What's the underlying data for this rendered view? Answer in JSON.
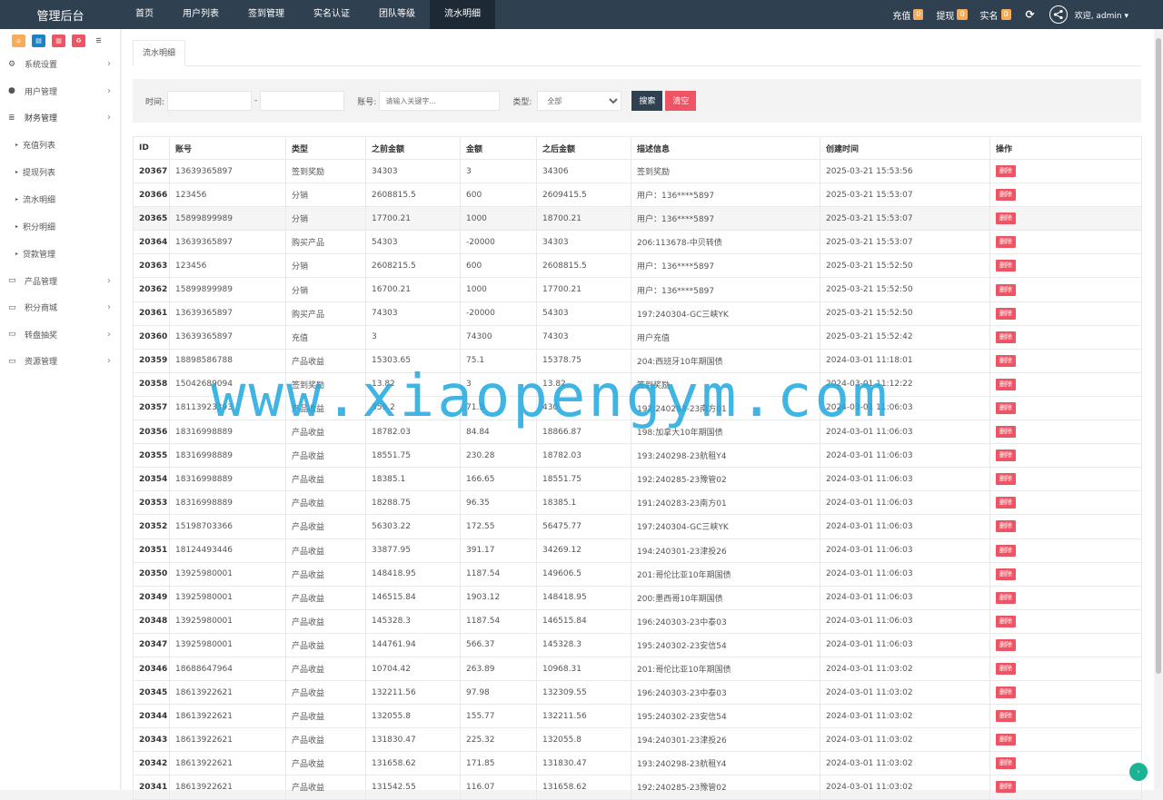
{
  "brand": "管理后台",
  "topnav": [
    "首页",
    "用户列表",
    "签到管理",
    "实名认证",
    "团队等级",
    "流水明细"
  ],
  "stats": [
    {
      "label": "充值",
      "count": "0"
    },
    {
      "label": "提现",
      "count": "0"
    },
    {
      "label": "实名",
      "count": "0"
    }
  ],
  "refresh_glyph": "⟳",
  "welcome": "欢迎, admin ▾",
  "quick_buttons": [
    {
      "icon": "home-icon",
      "glyph": "⌂",
      "color": "#f8ac59"
    },
    {
      "icon": "file-icon",
      "glyph": "▤",
      "color": "#1c84c6"
    },
    {
      "icon": "trash-icon",
      "glyph": "▥",
      "color": "#ed5565"
    },
    {
      "icon": "recycle-icon",
      "glyph": "♻",
      "color": "#ed5565"
    },
    {
      "icon": "list-icon",
      "glyph": "☰",
      "color": "#ffffff"
    }
  ],
  "sidebar": {
    "menus": [
      {
        "label": "系统设置",
        "icon": "gears-icon",
        "glyph": "⚙"
      },
      {
        "label": "用户管理",
        "icon": "user-icon",
        "glyph": "●"
      },
      {
        "label": "财务管理",
        "icon": "database-icon",
        "glyph": "≣"
      },
      {
        "label": "产品管理",
        "icon": "monitor-icon",
        "glyph": "▭"
      },
      {
        "label": "积分商城",
        "icon": "monitor-icon",
        "glyph": "▭"
      },
      {
        "label": "转盘抽奖",
        "icon": "monitor-icon",
        "glyph": "▭"
      },
      {
        "label": "资源管理",
        "icon": "monitor-icon",
        "glyph": "▭"
      }
    ],
    "finance_sub": [
      "充值列表",
      "提现列表",
      "流水明细",
      "积分明细",
      "贷款管理"
    ],
    "chevron": "›",
    "dot": "▸"
  },
  "tab_label": "流水明细",
  "search": {
    "time_label": "时间:",
    "dash": "-",
    "account_label": "账号:",
    "account_placeholder": "请输入关键字...",
    "type_label": "类型:",
    "type_selected": "全部",
    "search_btn": "搜索",
    "clear_btn": "清空"
  },
  "table": {
    "headers": [
      "ID",
      "账号",
      "类型",
      "之前金额",
      "金额",
      "之后金额",
      "描述信息",
      "创建时间",
      "操作"
    ],
    "delete_label": "删除",
    "rows": [
      [
        "20367",
        "13639365897",
        "签到奖励",
        "34303",
        "3",
        "34306",
        "签到奖励",
        "2025-03-21 15:53:56"
      ],
      [
        "20366",
        "123456",
        "分销",
        "2608815.5",
        "600",
        "2609415.5",
        "用户：136****5897",
        "2025-03-21 15:53:07"
      ],
      [
        "20365",
        "15899899989",
        "分销",
        "17700.21",
        "1000",
        "18700.21",
        "用户：136****5897",
        "2025-03-21 15:53:07"
      ],
      [
        "20364",
        "13639365897",
        "购买产品",
        "54303",
        "-20000",
        "34303",
        "206:113678-中贝转债",
        "2025-03-21 15:53:07"
      ],
      [
        "20363",
        "123456",
        "分销",
        "2608215.5",
        "600",
        "2608815.5",
        "用户：136****5897",
        "2025-03-21 15:52:50"
      ],
      [
        "20362",
        "15899899989",
        "分销",
        "16700.21",
        "1000",
        "17700.21",
        "用户：136****5897",
        "2025-03-21 15:52:50"
      ],
      [
        "20361",
        "13639365897",
        "购买产品",
        "74303",
        "-20000",
        "54303",
        "197:240304-GC三峡YK",
        "2025-03-21 15:52:50"
      ],
      [
        "20360",
        "13639365897",
        "充值",
        "3",
        "74300",
        "74303",
        "用户充值",
        "2025-03-21 15:52:42"
      ],
      [
        "20359",
        "18898586788",
        "产品收益",
        "15303.65",
        "75.1",
        "15378.75",
        "204:西班牙10年期国债",
        "2024-03-01 11:18:01"
      ],
      [
        "20358",
        "15042689094",
        "签到奖励",
        "13.82",
        "3",
        "13.82",
        "签到奖励",
        "2024-03-01 11:12:22"
      ],
      [
        "20357",
        "18113923393",
        "产品收益",
        "359.2",
        "71.5",
        "430",
        "192:240283-23南方01",
        "2024-03-01 11:06:03"
      ],
      [
        "20356",
        "18316998889",
        "产品收益",
        "18782.03",
        "84.84",
        "18866.87",
        "198:加拿大10年期国债",
        "2024-03-01 11:06:03"
      ],
      [
        "20355",
        "18316998889",
        "产品收益",
        "18551.75",
        "230.28",
        "18782.03",
        "193:240298-23航租Y4",
        "2024-03-01 11:06:03"
      ],
      [
        "20354",
        "18316998889",
        "产品收益",
        "18385.1",
        "166.65",
        "18551.75",
        "192:240285-23豫管02",
        "2024-03-01 11:06:03"
      ],
      [
        "20353",
        "18316998889",
        "产品收益",
        "18288.75",
        "96.35",
        "18385.1",
        "191:240283-23南方01",
        "2024-03-01 11:06:03"
      ],
      [
        "20352",
        "15198703366",
        "产品收益",
        "56303.22",
        "172.55",
        "56475.77",
        "197:240304-GC三峡YK",
        "2024-03-01 11:06:03"
      ],
      [
        "20351",
        "18124493446",
        "产品收益",
        "33877.95",
        "391.17",
        "34269.12",
        "194:240301-23津投26",
        "2024-03-01 11:06:03"
      ],
      [
        "20350",
        "13925980001",
        "产品收益",
        "148418.95",
        "1187.54",
        "149606.5",
        "201:哥伦比亚10年期国债",
        "2024-03-01 11:06:03"
      ],
      [
        "20349",
        "13925980001",
        "产品收益",
        "146515.84",
        "1903.12",
        "148418.95",
        "200:墨西哥10年期国债",
        "2024-03-01 11:06:03"
      ],
      [
        "20348",
        "13925980001",
        "产品收益",
        "145328.3",
        "1187.54",
        "146515.84",
        "196:240303-23中泰03",
        "2024-03-01 11:06:03"
      ],
      [
        "20347",
        "13925980001",
        "产品收益",
        "144761.94",
        "566.37",
        "145328.3",
        "195:240302-23安信54",
        "2024-03-01 11:06:03"
      ],
      [
        "20346",
        "18688647964",
        "产品收益",
        "10704.42",
        "263.89",
        "10968.31",
        "201:哥伦比亚10年期国债",
        "2024-03-01 11:03:02"
      ],
      [
        "20345",
        "18613922621",
        "产品收益",
        "132211.56",
        "97.98",
        "132309.55",
        "196:240303-23中泰03",
        "2024-03-01 11:03:02"
      ],
      [
        "20344",
        "18613922621",
        "产品收益",
        "132055.8",
        "155.77",
        "132211.56",
        "195:240302-23安信54",
        "2024-03-01 11:03:02"
      ],
      [
        "20343",
        "18613922621",
        "产品收益",
        "131830.47",
        "225.32",
        "132055.8",
        "194:240301-23津投26",
        "2024-03-01 11:03:02"
      ],
      [
        "20342",
        "18613922621",
        "产品收益",
        "131658.62",
        "171.85",
        "131830.47",
        "193:240298-23航租Y4",
        "2024-03-01 11:03:02"
      ],
      [
        "20341",
        "18613922621",
        "产品收益",
        "131542.55",
        "116.07",
        "131658.62",
        "192:240285-23豫管02",
        "2024-03-01 11:03:02"
      ]
    ]
  },
  "watermark": "www.xiaopengym.com"
}
